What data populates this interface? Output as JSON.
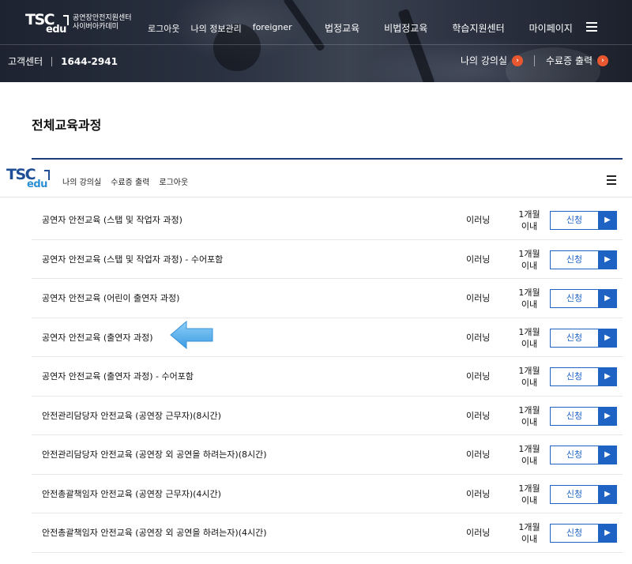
{
  "header": {
    "logo_tsc": "TSC",
    "logo_edu": "edu",
    "org_line1": "공연장안전지원센터",
    "org_line2": "사이버아카데미",
    "top_links": [
      "로그아웃",
      "나의 정보관리",
      "foreigner"
    ],
    "gnb": [
      "법정교육",
      "비법정교육",
      "학습지원센터",
      "마이페이지"
    ],
    "cs_label": "고객센터",
    "cs_phone": "1644-2941",
    "quick_links": [
      {
        "label": "나의 강의실",
        "icon": "chevron-right-icon"
      },
      {
        "label": "수료증 출력",
        "icon": "chevron-right-icon"
      }
    ]
  },
  "page": {
    "title": "전체교육과정"
  },
  "sticky_bar": {
    "links": [
      "나의 강의실",
      "수료증 출력",
      "로그아웃"
    ]
  },
  "courses": [
    {
      "name": "공연자 안전교육 (스탭 및 작업자 과정)",
      "type": "이러닝",
      "period_line1": "1개월",
      "period_line2": "이내",
      "apply_label": "신청"
    },
    {
      "name": "공연자 안전교육 (스탭 및 작업자 과정) - 수어포함",
      "type": "이러닝",
      "period_line1": "1개월",
      "period_line2": "이내",
      "apply_label": "신청"
    },
    {
      "name": "공연자 안전교육 (어린이 출연자 과정)",
      "type": "이러닝",
      "period_line1": "1개월",
      "period_line2": "이내",
      "apply_label": "신청"
    },
    {
      "name": "공연자 안전교육 (출연자 과정)",
      "type": "이러닝",
      "period_line1": "1개월",
      "period_line2": "이내",
      "apply_label": "신청"
    },
    {
      "name": "공연자 안전교육 (출연자 과정) - 수어포함",
      "type": "이러닝",
      "period_line1": "1개월",
      "period_line2": "이내",
      "apply_label": "신청"
    },
    {
      "name": "안전관리담당자 안전교육 (공연장 근무자)(8시간)",
      "type": "이러닝",
      "period_line1": "1개월",
      "period_line2": "이내",
      "apply_label": "신청"
    },
    {
      "name": "안전관리담당자 안전교육 (공연장 외 공연을 하려는자)(8시간)",
      "type": "이러닝",
      "period_line1": "1개월",
      "period_line2": "이내",
      "apply_label": "신청"
    },
    {
      "name": "안전총괄책임자 안전교육 (공연장 근무자)(4시간)",
      "type": "이러닝",
      "period_line1": "1개월",
      "period_line2": "이내",
      "apply_label": "신청"
    },
    {
      "name": "안전총괄책임자 안전교육 (공연장 외 공연을 하려는자)(4시간)",
      "type": "이러닝",
      "period_line1": "1개월",
      "period_line2": "이내",
      "apply_label": "신청"
    }
  ],
  "colors": {
    "accent_blue": "#1e63c4",
    "title_rule": "#1f3f7a",
    "quick_icon": "#e8572f",
    "annotation_arrow": "#4aa8ea"
  }
}
